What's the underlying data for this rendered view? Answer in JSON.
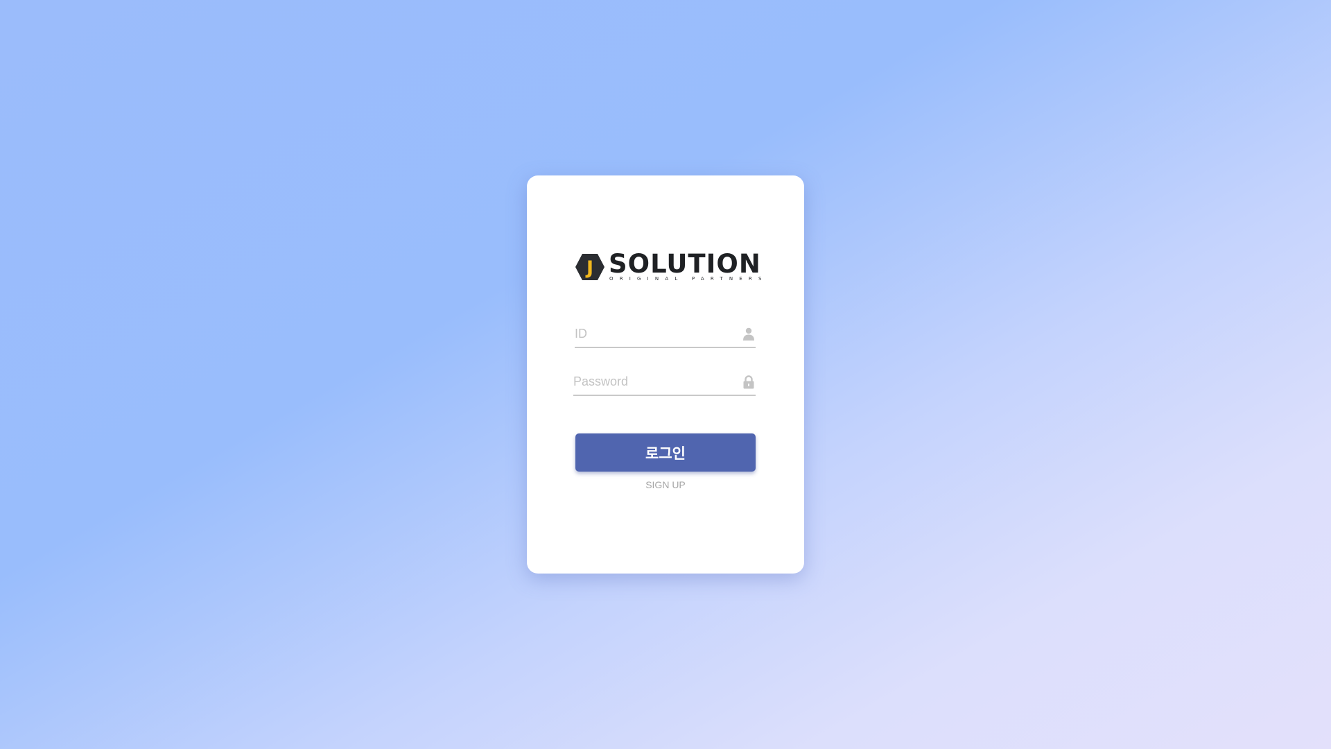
{
  "logo": {
    "wordmark": "SOLUTION",
    "mark_letter": "J",
    "tagline": "ORIGINAL PARTNERS",
    "colors": {
      "hex": "#2b2d31",
      "letter": "#f2b81d",
      "text": "#1f2124"
    }
  },
  "form": {
    "id_field": {
      "placeholder": "ID",
      "value": "",
      "icon": "user-icon"
    },
    "password_field": {
      "placeholder": "Password",
      "value": "",
      "icon": "lock-icon"
    },
    "login_label": "로그인",
    "signup_label": "SIGN UP"
  },
  "colors": {
    "button": "#5065af",
    "background_start": "#9bbcfb",
    "background_end": "#e3e0fb"
  }
}
